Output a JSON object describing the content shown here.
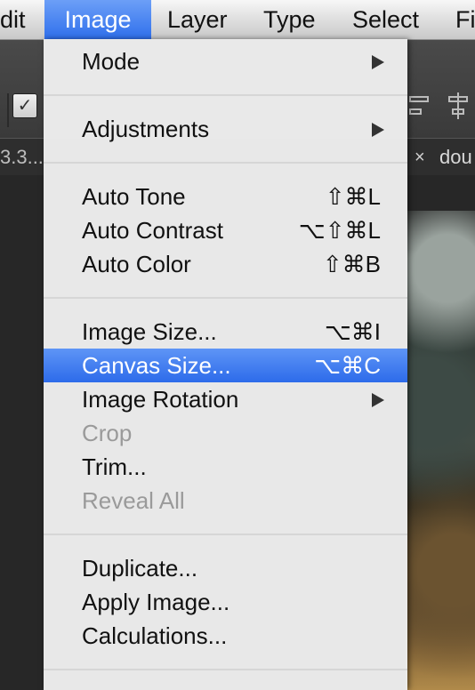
{
  "menubar": {
    "items": [
      {
        "label": "dit"
      },
      {
        "label": "Image"
      },
      {
        "label": "Layer"
      },
      {
        "label": "Type"
      },
      {
        "label": "Select"
      },
      {
        "label": "Fi"
      }
    ]
  },
  "document_tabs": {
    "left_label": "3.3...",
    "close_glyph": "×",
    "right_label": "dou"
  },
  "image_menu": {
    "items": [
      {
        "label": "Mode",
        "submenu": true
      },
      {
        "label": "Adjustments",
        "submenu": true
      },
      {
        "label": "Auto Tone",
        "shortcut": "⇧⌘L"
      },
      {
        "label": "Auto Contrast",
        "shortcut": "⌥⇧⌘L"
      },
      {
        "label": "Auto Color",
        "shortcut": "⇧⌘B"
      },
      {
        "label": "Image Size...",
        "shortcut": "⌥⌘I"
      },
      {
        "label": "Canvas Size...",
        "shortcut": "⌥⌘C",
        "highlighted": true
      },
      {
        "label": "Image Rotation",
        "submenu": true
      },
      {
        "label": "Crop",
        "disabled": true
      },
      {
        "label": "Trim..."
      },
      {
        "label": "Reveal All",
        "disabled": true
      },
      {
        "label": "Duplicate..."
      },
      {
        "label": "Apply Image..."
      },
      {
        "label": "Calculations..."
      }
    ]
  },
  "colors": {
    "highlight": "#2d6bea",
    "menu_background": "#eeeeee",
    "disabled_text": "#9a9a9a"
  }
}
